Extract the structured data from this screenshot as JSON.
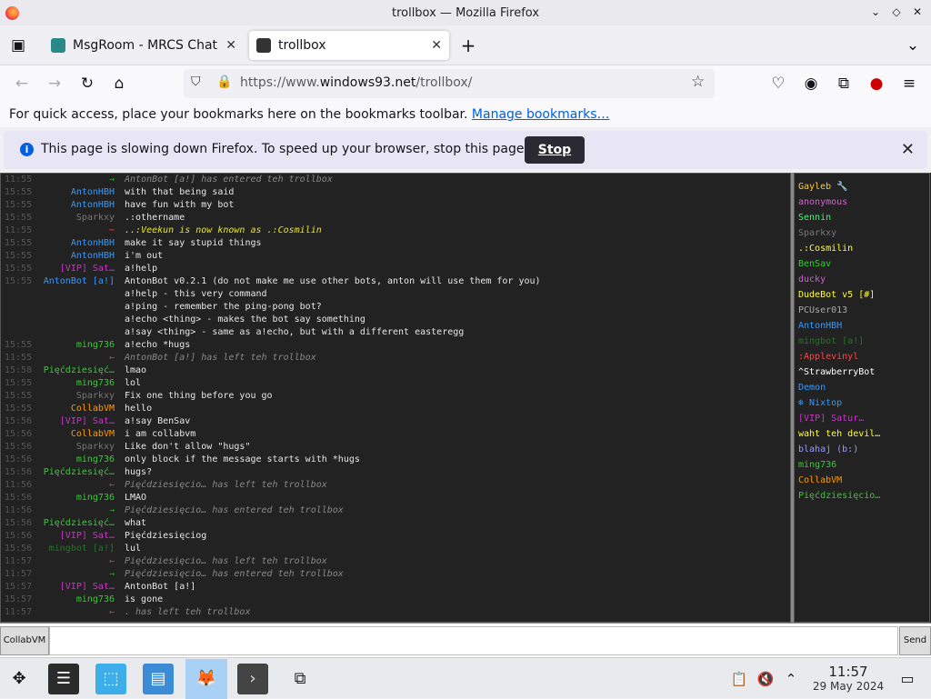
{
  "window": {
    "title": "trollbox — Mozilla Firefox"
  },
  "tabs": [
    {
      "label": "MsgRoom - MRCS Chat",
      "active": false
    },
    {
      "label": "trollbox",
      "active": true
    }
  ],
  "url": {
    "prefix": "https://www.",
    "domain": "windows93.net",
    "path": "/trollbox/"
  },
  "bookmarks": {
    "text": "For quick access, place your bookmarks here on the bookmarks toolbar. ",
    "link": "Manage bookmarks…"
  },
  "notification": {
    "message": "This page is slowing down Firefox. To speed up your browser, stop this page.",
    "stop_label": "Stop"
  },
  "chat": {
    "messages": [
      {
        "time": "11:55",
        "nick": "→",
        "nick_color": "#00c000",
        "text": "AntonBot [a!] has entered teh trollbox",
        "system": true
      },
      {
        "time": "15:55",
        "nick": "AntonHBH",
        "nick_color": "#3399ff",
        "text": "with that being said"
      },
      {
        "time": "15:55",
        "nick": "AntonHBH",
        "nick_color": "#3399ff",
        "text": "have fun with my bot"
      },
      {
        "time": "15:55",
        "nick": "Sparkxy",
        "nick_color": "#777777",
        "text": ".:othername"
      },
      {
        "time": "11:55",
        "nick": "~",
        "nick_color": "#ff4444",
        "text": "..:Veekun is now known as .:Cosmilin",
        "system": true,
        "yellow": true
      },
      {
        "time": "15:55",
        "nick": "AntonHBH",
        "nick_color": "#3399ff",
        "text": "make it say stupid things"
      },
      {
        "time": "15:55",
        "nick": "AntonHBH",
        "nick_color": "#3399ff",
        "text": "i'm out"
      },
      {
        "time": "15:55",
        "nick": "[VIP] Sat…",
        "nick_color": "#cc33cc",
        "text": "a!help"
      },
      {
        "time": "15:55",
        "nick": "AntonBot [a!]",
        "nick_color": "#3399ff",
        "text": "AntonBot v0.2.1 (do not make me use other bots, anton will use them for you)"
      },
      {
        "time": "",
        "nick": "",
        "nick_color": "#3399ff",
        "text": "a!help - this very command"
      },
      {
        "time": "",
        "nick": "",
        "nick_color": "#3399ff",
        "text": "a!ping - remember the ping-pong bot?"
      },
      {
        "time": "",
        "nick": "",
        "nick_color": "#3399ff",
        "text": "a!echo <thing> - makes the bot say something"
      },
      {
        "time": "",
        "nick": "",
        "nick_color": "#3399ff",
        "text": "a!say <thing> - same as a!echo, but with a different easteregg"
      },
      {
        "time": "15:55",
        "nick": "ming736",
        "nick_color": "#33cc33",
        "text": "a!echo *hugs"
      },
      {
        "time": "11:55",
        "nick": "←",
        "nick_color": "#ff3333",
        "text": "AntonBot [a!] has left teh trollbox",
        "system": true
      },
      {
        "time": "15:58",
        "nick": "Pięćdziesięć…",
        "nick_color": "#33cc33",
        "text": "lmao"
      },
      {
        "time": "15:55",
        "nick": "ming736",
        "nick_color": "#33cc33",
        "text": "lol"
      },
      {
        "time": "15:55",
        "nick": "Sparkxy",
        "nick_color": "#777777",
        "text": "Fix one thing before you go"
      },
      {
        "time": "15:55",
        "nick": "CollabVM",
        "nick_color": "#ff9900",
        "text": "hello"
      },
      {
        "time": "15:56",
        "nick": "[VIP] Sat…",
        "nick_color": "#cc33cc",
        "text": "a!say BenSav"
      },
      {
        "time": "15:56",
        "nick": "CollabVM",
        "nick_color": "#ff9900",
        "text": "i am collabvm"
      },
      {
        "time": "15:56",
        "nick": "Sparkxy",
        "nick_color": "#777777",
        "text": "Like don't allow \"hugs\""
      },
      {
        "time": "15:56",
        "nick": "ming736",
        "nick_color": "#33cc33",
        "text": "only block if the message starts with *hugs"
      },
      {
        "time": "15:56",
        "nick": "Pięćdziesięć…",
        "nick_color": "#33cc33",
        "text": "hugs?"
      },
      {
        "time": "11:56",
        "nick": "←",
        "nick_color": "#ff3333",
        "text": "Pięćdziesięcio… has left teh trollbox",
        "system": true
      },
      {
        "time": "15:56",
        "nick": "ming736",
        "nick_color": "#33cc33",
        "text": "LMAO"
      },
      {
        "time": "11:56",
        "nick": "→",
        "nick_color": "#00c000",
        "text": "Pięćdziesięcio… has entered teh trollbox",
        "system": true
      },
      {
        "time": "15:56",
        "nick": "Pięćdziesięć…",
        "nick_color": "#33cc33",
        "text": "what"
      },
      {
        "time": "15:56",
        "nick": "[VIP] Sat…",
        "nick_color": "#cc33cc",
        "text": "Pięćdziesięciog"
      },
      {
        "time": "15:56",
        "nick": "mingbot [a!]",
        "nick_color": "#227722",
        "text": "lul"
      },
      {
        "time": "11:57",
        "nick": "←",
        "nick_color": "#ff3333",
        "text": "Pięćdziesięcio… has left teh trollbox",
        "system": true
      },
      {
        "time": "11:57",
        "nick": "→",
        "nick_color": "#00c000",
        "text": "Pięćdziesięcio… has entered teh trollbox",
        "system": true
      },
      {
        "time": "15:57",
        "nick": "[VIP] Sat…",
        "nick_color": "#cc33cc",
        "text": "AntonBot [a!]"
      },
      {
        "time": "15:57",
        "nick": "ming736",
        "nick_color": "#33cc33",
        "text": "is gone"
      },
      {
        "time": "11:57",
        "nick": "←",
        "nick_color": "#ff3333",
        "text": ". has left teh trollbox",
        "system": true
      }
    ]
  },
  "users": [
    {
      "name": "Gayleb 🔧",
      "color": "#ffcc33"
    },
    {
      "name": "anonymous",
      "color": "#cc66cc"
    },
    {
      "name": "Sennin",
      "color": "#33ff66"
    },
    {
      "name": "Sparkxy",
      "color": "#777777"
    },
    {
      "name": ".:Cosmilin",
      "color": "#ffff33"
    },
    {
      "name": "BenSav",
      "color": "#33cc33"
    },
    {
      "name": "ducky",
      "color": "#cc66cc"
    },
    {
      "name": "DudeBot v5 [#]",
      "color": "#ffff33"
    },
    {
      "name": "PCUser013",
      "color": "#aaaaaa"
    },
    {
      "name": "AntonHBH",
      "color": "#3399ff"
    },
    {
      "name": "mingbot [a!]",
      "color": "#227722"
    },
    {
      "name": ":Applevinyl",
      "color": "#ff4444"
    },
    {
      "name": "^StrawberryBot",
      "color": "#ffffff"
    },
    {
      "name": "Demon",
      "color": "#3399ff"
    },
    {
      "name": "❄ Nixtop",
      "color": "#3399ff"
    },
    {
      "name": "[VIP] Satur…",
      "color": "#cc33cc"
    },
    {
      "name": "waht teh devil…",
      "color": "#ffff33"
    },
    {
      "name": "blahaj (b:)",
      "color": "#9999ff"
    },
    {
      "name": "ming736",
      "color": "#33cc33"
    },
    {
      "name": "CollabVM",
      "color": "#ff9900"
    },
    {
      "name": "Pięćdziesięcio…",
      "color": "#33cc33"
    }
  ],
  "input": {
    "nick": "CollabVM",
    "value": "",
    "send_label": "Send"
  },
  "taskbar": {
    "time": "11:57",
    "date": "29 May 2024"
  }
}
